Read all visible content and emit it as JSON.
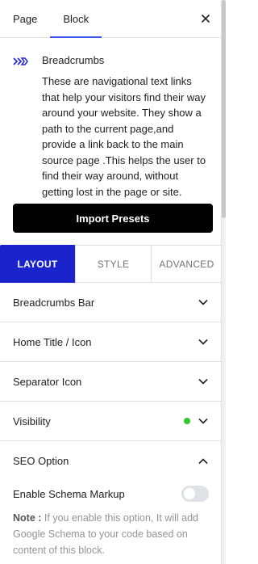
{
  "header": {
    "tabs": [
      {
        "label": "Page",
        "active": false
      },
      {
        "label": "Block",
        "active": true
      }
    ],
    "close_icon": "close-icon",
    "accent_color": "#3858e9"
  },
  "block": {
    "icon": "breadcrumbs-icon",
    "title": "Breadcrumbs",
    "description": "These are navigational text links that help your visitors find their way around your website. They show a path to the current page,and provide a link back to the main source page .This helps the user to find their way around, without getting lost in the page or site."
  },
  "import_button": {
    "label": "Import Presets"
  },
  "settings_tabs": [
    {
      "label": "LAYOUT",
      "active": true
    },
    {
      "label": "STYLE",
      "active": false
    },
    {
      "label": "ADVANCED",
      "active": false
    }
  ],
  "settings_tab_active_color": "#1b24cc",
  "panels": [
    {
      "label": "Breadcrumbs Bar",
      "expanded": false
    },
    {
      "label": "Home Title / Icon",
      "expanded": false
    },
    {
      "label": "Separator Icon",
      "expanded": false
    },
    {
      "label": "Visibility",
      "expanded": false,
      "indicator_color": "#2ec72e"
    },
    {
      "label": "SEO Option",
      "expanded": true
    }
  ],
  "seo": {
    "toggle_label": "Enable Schema Markup",
    "toggle_on": false,
    "note_label": "Note :",
    "note_text": " If you enable this option, It will add Google Schema to your code based on content of this block."
  }
}
